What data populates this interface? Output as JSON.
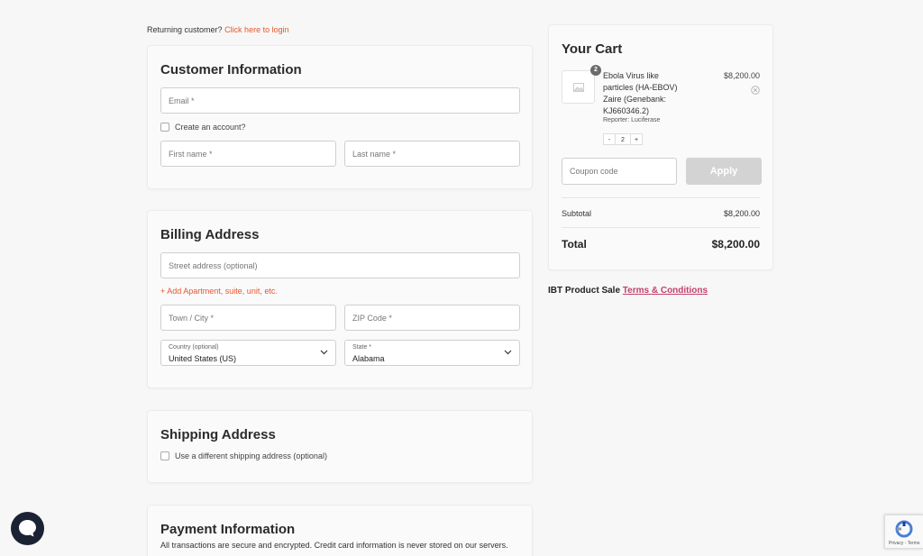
{
  "returning": {
    "prefix": "Returning customer?",
    "link": "Click here to login"
  },
  "customer": {
    "title": "Customer Information",
    "email_placeholder": "Email *",
    "create_account": "Create an account?",
    "first_name_placeholder": "First name *",
    "last_name_placeholder": "Last name *"
  },
  "billing": {
    "title": "Billing Address",
    "street_placeholder": "Street address (optional)",
    "add_apartment": "+ Add Apartment, suite, unit, etc.",
    "town_placeholder": "Town / City *",
    "zip_placeholder": "ZIP Code *",
    "country_label": "Country (optional)",
    "country_value": "United States (US)",
    "state_label": "State *",
    "state_value": "Alabama"
  },
  "shipping": {
    "title": "Shipping Address",
    "different_address": "Use a different shipping address (optional)"
  },
  "payment": {
    "title": "Payment Information",
    "note": "All transactions are secure and encrypted. Credit card information is never stored on our servers."
  },
  "cart": {
    "title": "Your Cart",
    "item": {
      "name": "Ebola Virus like particles (HA-EBOV) Zaire (Genebank: KJ660346.2)",
      "reporter_label": "Reporter:",
      "reporter_value": "Luciferase",
      "price": "$8,200.00",
      "quantity": "2",
      "badge": "2",
      "minus": "-",
      "plus": "+"
    },
    "coupon_placeholder": "Coupon code",
    "apply_label": "Apply",
    "subtotal_label": "Subtotal",
    "subtotal_value": "$8,200.00",
    "total_label": "Total",
    "total_value": "$8,200.00"
  },
  "terms": {
    "prefix": "IBT Product Sale",
    "link": "Terms & Conditions"
  },
  "recaptcha": {
    "text": "Privacy - Terms"
  },
  "colors": {
    "accent": "#e4572e",
    "terms_link": "#c2416b",
    "apply_disabled": "#d3d3d3",
    "chat_bubble": "#1a2233"
  },
  "icons": {
    "remove": "circle-x-icon",
    "chevron": "chevron-down-icon",
    "image": "image-placeholder-icon",
    "chat": "chat-bubble-icon",
    "recaptcha": "recaptcha-logo-icon"
  }
}
